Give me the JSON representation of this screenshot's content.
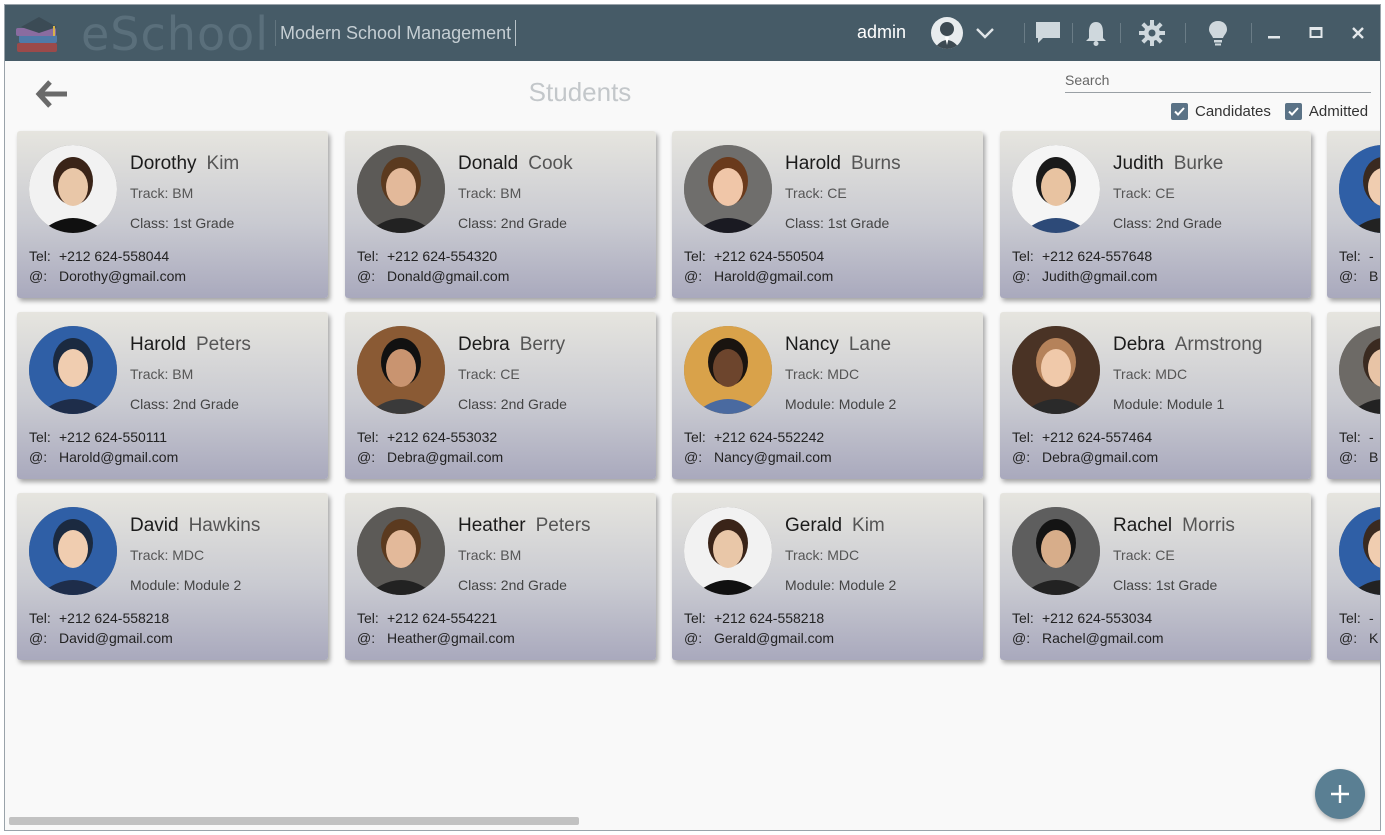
{
  "app": {
    "brand": "eSchool",
    "tagline": "Modern School Management"
  },
  "header": {
    "user": "admin"
  },
  "page": {
    "title": "Students"
  },
  "search": {
    "placeholder": "Search"
  },
  "filters": [
    {
      "label": "Candidates",
      "checked": true
    },
    {
      "label": "Admitted",
      "checked": true
    }
  ],
  "labels": {
    "tel": "Tel:",
    "email": "@:"
  },
  "students": [
    {
      "first": "Dorothy",
      "last": "Kim",
      "track": "Track: BM",
      "detail": "Class: 1st Grade",
      "tel": "+212 624-558044",
      "email": "Dorothy@gmail.com",
      "bg": "#f2f2f2",
      "skin": "#e9c7a8",
      "hair": "#3a2418",
      "shirt": "#101010"
    },
    {
      "first": "Donald",
      "last": "Cook",
      "track": "Track: BM",
      "detail": "Class: 2nd Grade",
      "tel": "+212 624-554320",
      "email": "Donald@gmail.com",
      "bg": "#5c5a57",
      "skin": "#e3b99a",
      "hair": "#5b3a1f",
      "shirt": "#222222"
    },
    {
      "first": "Harold",
      "last": "Burns",
      "track": "Track: CE",
      "detail": "Class: 1st Grade",
      "tel": "+212 624-550504",
      "email": "Harold@gmail.com",
      "bg": "#6f6e6c",
      "skin": "#f0c6a8",
      "hair": "#6a3a1c",
      "shirt": "#1a1a22"
    },
    {
      "first": "Judith",
      "last": "Burke",
      "track": "Track: CE",
      "detail": "Class: 2nd Grade",
      "tel": "+212 624-557648",
      "email": "Judith@gmail.com",
      "bg": "#f5f5f5",
      "skin": "#e8c3a1",
      "hair": "#1a1a1a",
      "shirt": "#2d4a78"
    },
    {
      "first": "Harold",
      "last": "Peters",
      "track": "Track: BM",
      "detail": "Class: 2nd Grade",
      "tel": "+212 624-550111",
      "email": "Harold@gmail.com",
      "bg": "#2f5fa6",
      "skin": "#f0cdb0",
      "hair": "#1b2a40",
      "shirt": "#1e2d4a"
    },
    {
      "first": "Debra",
      "last": "Berry",
      "track": "Track: CE",
      "detail": "Class: 2nd Grade",
      "tel": "+212 624-553032",
      "email": "Debra@gmail.com",
      "bg": "#8a5a34",
      "skin": "#c99470",
      "hair": "#111111",
      "shirt": "#3a3a3a"
    },
    {
      "first": "Nancy",
      "last": "Lane",
      "track": "Track: MDC",
      "detail": "Module: Module 2",
      "tel": "+212 624-552242",
      "email": "Nancy@gmail.com",
      "bg": "#d9a24a",
      "skin": "#6d452d",
      "hair": "#1a1410",
      "shirt": "#4a6aa0"
    },
    {
      "first": "Debra",
      "last": "Armstrong",
      "track": "Track: MDC",
      "detail": "Module: Module 1",
      "tel": "+212 624-557464",
      "email": "Debra@gmail.com",
      "bg": "#4a3325",
      "skin": "#f0c9aa",
      "hair": "#b5825a",
      "shirt": "#2a2a2a"
    },
    {
      "first": "David",
      "last": "Hawkins",
      "track": "Track: MDC",
      "detail": "Module: Module 2",
      "tel": "+212 624-558218",
      "email": "David@gmail.com",
      "bg": "#2f5fa6",
      "skin": "#f0cdb0",
      "hair": "#1b2a40",
      "shirt": "#1e2d4a"
    },
    {
      "first": "Heather",
      "last": "Peters",
      "track": "Track: BM",
      "detail": "Class: 2nd Grade",
      "tel": "+212 624-554221",
      "email": "Heather@gmail.com",
      "bg": "#5c5a57",
      "skin": "#e3b99a",
      "hair": "#5b3a1f",
      "shirt": "#222222"
    },
    {
      "first": "Gerald",
      "last": "Kim",
      "track": "Track: MDC",
      "detail": "Module: Module 2",
      "tel": "+212 624-558218",
      "email": "Gerald@gmail.com",
      "bg": "#f2f2f2",
      "skin": "#e9c7a8",
      "hair": "#3a2418",
      "shirt": "#101010"
    },
    {
      "first": "Rachel",
      "last": "Morris",
      "track": "Track: CE",
      "detail": "Class: 1st Grade",
      "tel": "+212 624-553034",
      "email": "Rachel@gmail.com",
      "bg": "#5e5e5e",
      "skin": "#d7ad8a",
      "hair": "#141414",
      "shirt": "#222222"
    }
  ],
  "partial": [
    {
      "tel": "-",
      "mail_initial": "B",
      "bg": "#2f5fa6",
      "skin": "#f0cdb0"
    },
    {
      "tel": "-",
      "mail_initial": "B",
      "bg": "#6d6a66",
      "skin": "#e8c4a6"
    },
    {
      "tel": "-",
      "mail_initial": "K",
      "bg": "#2f5fa6",
      "skin": "#f0cdb0"
    }
  ],
  "colors": {
    "titlebar": "#465b67",
    "accent": "#5a7f93",
    "checkbox": "#5a7286"
  }
}
